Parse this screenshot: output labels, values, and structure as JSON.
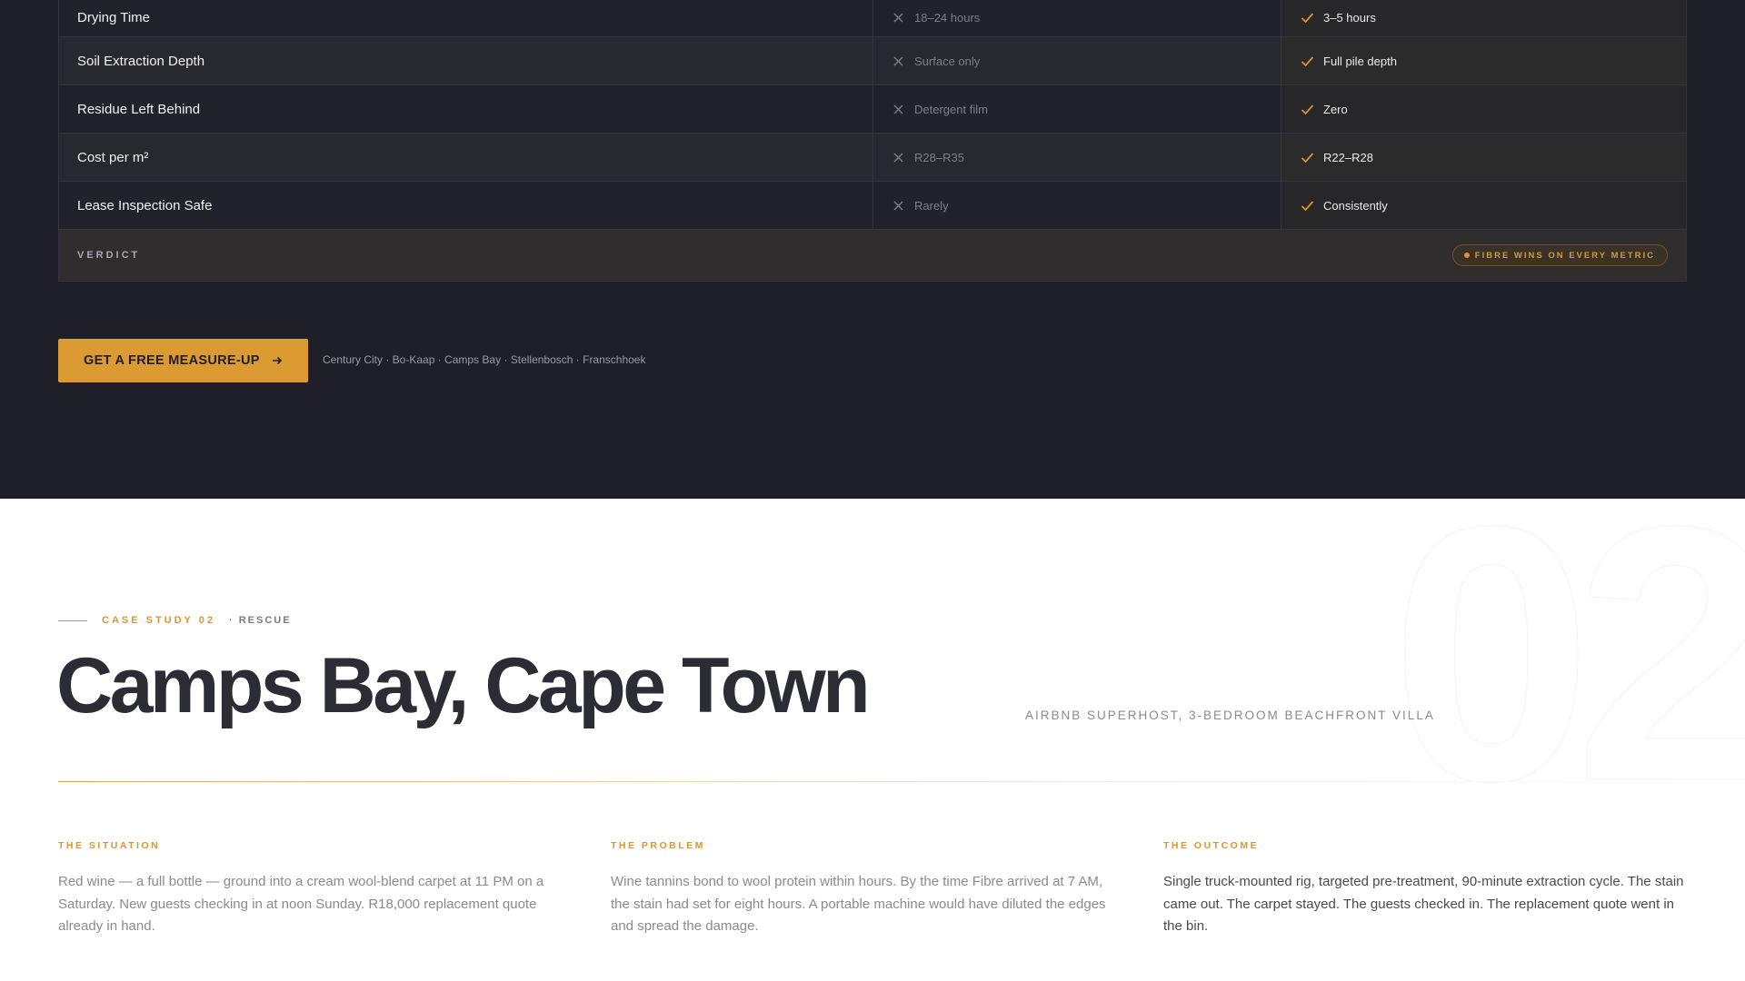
{
  "comparison": {
    "rows": [
      {
        "label": "Drying Time",
        "other": "18–24 hours",
        "fibre": "3–5 hours"
      },
      {
        "label": "Soil Extraction Depth",
        "other": "Surface only",
        "fibre": "Full pile depth"
      },
      {
        "label": "Residue Left Behind",
        "other": "Detergent film",
        "fibre": "Zero"
      },
      {
        "label": "Cost per m²",
        "other": "R28–R35",
        "fibre": "R22–R28"
      },
      {
        "label": "Lease Inspection Safe",
        "other": "Rarely",
        "fibre": "Consistently"
      }
    ],
    "verdict_label": "VERDICT",
    "verdict_badge": "FIBRE WINS ON EVERY METRIC"
  },
  "cta": {
    "label": "GET A FREE MEASURE-UP",
    "areas": "Century City · Bo-Kaap · Camps Bay · Stellenbosch · Franschhoek"
  },
  "case_study": {
    "bg_number": "02",
    "eyebrow_case": "CASE STUDY 02",
    "eyebrow_tag": "· RESCUE",
    "title": "Camps Bay, Cape Town",
    "subtitle": "AIRBNB SUPERHOST, 3-BEDROOM BEACHFRONT VILLA",
    "columns": [
      {
        "label": "THE SITUATION",
        "text": "Red wine — a full bottle — ground into a cream wool-blend carpet at 11 PM on a Saturday. New guests checking in at noon Sunday. R18,000 replacement quote already in hand."
      },
      {
        "label": "THE PROBLEM",
        "text": "Wine tannins bond to wool protein within hours. By the time Fibre arrived at 7 AM, the stain had set for eight hours. A portable machine would have diluted the edges and spread the damage."
      },
      {
        "label": "THE OUTCOME",
        "text": "Single truck-mounted rig, targeted pre-treatment, 90-minute extraction cycle. The stain came out. The carpet stayed. The guests checked in. The replacement quote went in the bin."
      }
    ]
  },
  "colors": {
    "accent": "#d9962e",
    "dark_bg": "#1f1f29",
    "title": "#2c2c34"
  }
}
